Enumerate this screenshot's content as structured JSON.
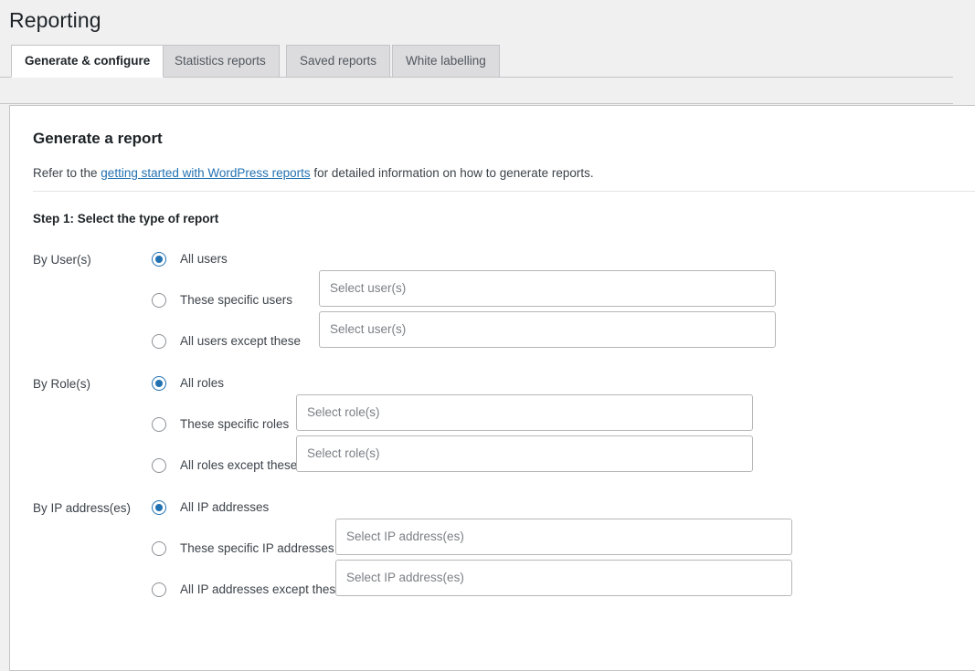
{
  "header": {
    "title": "Reporting"
  },
  "tabs": [
    {
      "label": "Generate & configure",
      "active": true
    },
    {
      "label": "Statistics reports",
      "active": false
    },
    {
      "label": "Saved reports",
      "active": false
    },
    {
      "label": "White labelling",
      "active": false
    }
  ],
  "panel": {
    "section_title": "Generate a report",
    "intro_before": "Refer to the ",
    "intro_link": "getting started with WordPress reports",
    "intro_after": " for detailed information on how to generate reports.",
    "step_title": "Step 1: Select the type of report"
  },
  "filters": {
    "users": {
      "group_label": "By User(s)",
      "options": [
        {
          "label": "All users",
          "checked": true
        },
        {
          "label": "These specific users",
          "checked": false,
          "placeholder": "Select user(s)"
        },
        {
          "label": "All users except these",
          "checked": false,
          "placeholder": "Select user(s)"
        }
      ]
    },
    "roles": {
      "group_label": "By Role(s)",
      "options": [
        {
          "label": "All roles",
          "checked": true
        },
        {
          "label": "These specific roles",
          "checked": false,
          "placeholder": "Select role(s)"
        },
        {
          "label": "All roles except these",
          "checked": false,
          "placeholder": "Select role(s)"
        }
      ]
    },
    "ips": {
      "group_label": "By IP address(es)",
      "options": [
        {
          "label": "All IP addresses",
          "checked": true
        },
        {
          "label": "These specific IP addresses",
          "checked": false,
          "placeholder": "Select IP address(es)"
        },
        {
          "label": "All IP addresses except these",
          "checked": false,
          "placeholder": "Select IP address(es)"
        }
      ]
    }
  },
  "colors": {
    "accent": "#2271b1",
    "page_bg": "#f0f0f1",
    "panel_bg": "#ffffff",
    "border": "#c3c4c7",
    "text": "#3c434a",
    "heading": "#1d2327",
    "tab_inactive_bg": "#dcdcde",
    "placeholder": "#7b7f85"
  }
}
